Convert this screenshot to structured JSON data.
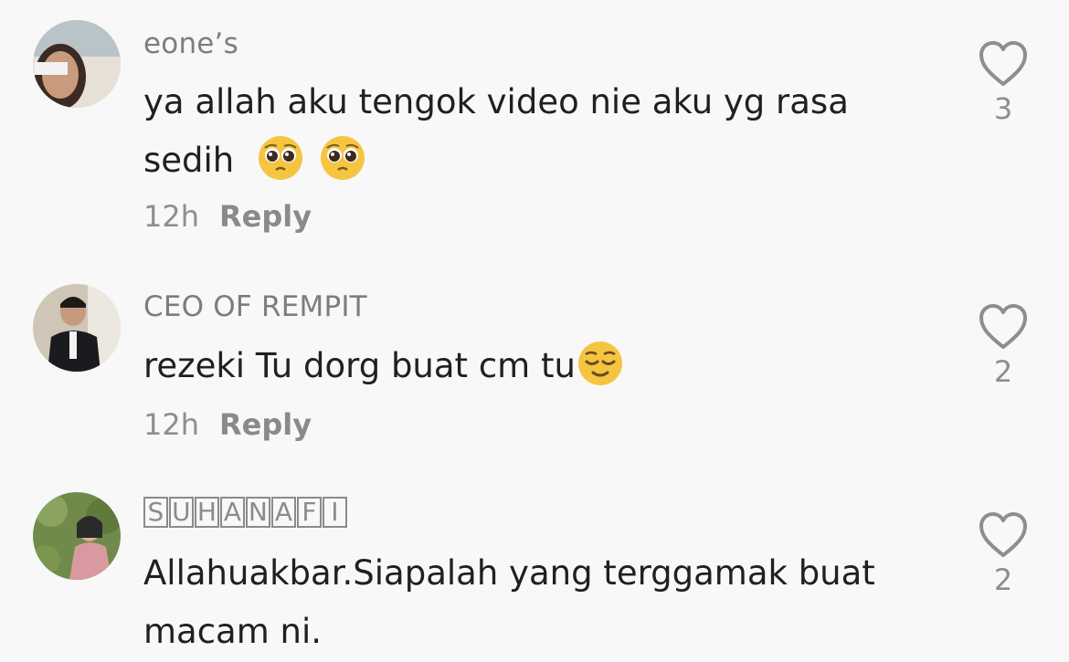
{
  "comments": [
    {
      "username": "eone’s",
      "text": "ya allah aku tengok video nie aku yg rasa sedih",
      "text_line1": "ya allah aku tengok video nie aku yg rasa",
      "text_line2": "sedih",
      "emojis": [
        "pleading-face",
        "pleading-face"
      ],
      "time": "12h",
      "reply_label": "Reply",
      "likes": "3"
    },
    {
      "username": "CEO OF REMPIT",
      "text": "rezeki Tu dorg buat cm tu",
      "emojis": [
        "relieved-face"
      ],
      "time": "12h",
      "reply_label": "Reply",
      "likes": "2"
    },
    {
      "username": "SUHANAFI",
      "username_letters": [
        "S",
        "U",
        "H",
        "A",
        "N",
        "A",
        "F",
        "I"
      ],
      "text_line1": "Allahuakbar.Siapalah yang terggamak buat",
      "text_line2": "macam ni.",
      "likes": "2"
    }
  ],
  "icons": {
    "like": "heart-outline-icon"
  },
  "colors": {
    "background": "#f8f8f8",
    "text": "#202020",
    "muted": "#8e8e8e"
  }
}
